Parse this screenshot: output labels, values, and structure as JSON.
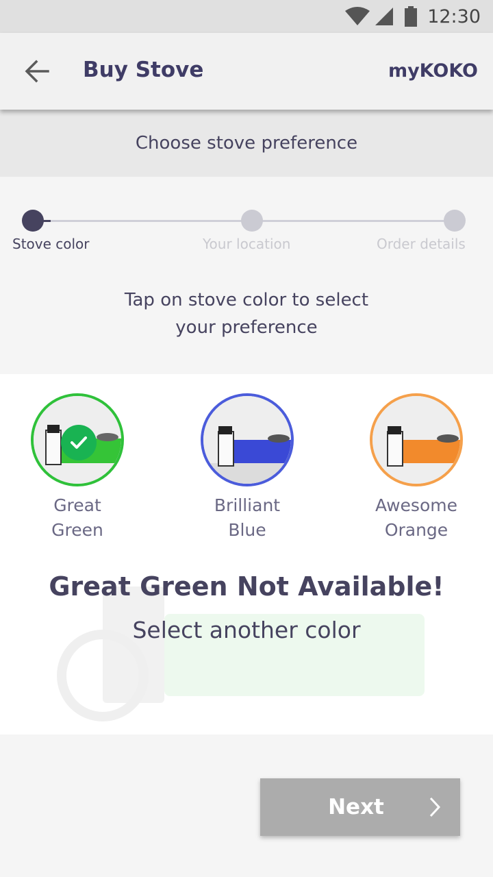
{
  "status_bar": {
    "time": "12:30"
  },
  "app_bar": {
    "title": "Buy Stove",
    "brand": "myKOKO"
  },
  "section_header": "Choose stove preference",
  "stepper": {
    "steps": [
      {
        "label": "Stove color",
        "active": true
      },
      {
        "label": "Your location",
        "active": false
      },
      {
        "label": "Order details",
        "active": false
      }
    ]
  },
  "instruction": {
    "line1": "Tap on stove color to select",
    "line2": "your preference"
  },
  "colors": [
    {
      "line1": "Great",
      "line2": "Green",
      "accent": "#2fc13a",
      "selected": true
    },
    {
      "line1": "Brilliant",
      "line2": "Blue",
      "accent": "#4b5cdb",
      "selected": false
    },
    {
      "line1": "Awesome",
      "line2": "Orange",
      "accent": "#f5a04b",
      "selected": false
    }
  ],
  "notice": {
    "title": "Great Green Not Available!",
    "subtitle": "Select another color"
  },
  "next_button": {
    "label": "Next"
  }
}
